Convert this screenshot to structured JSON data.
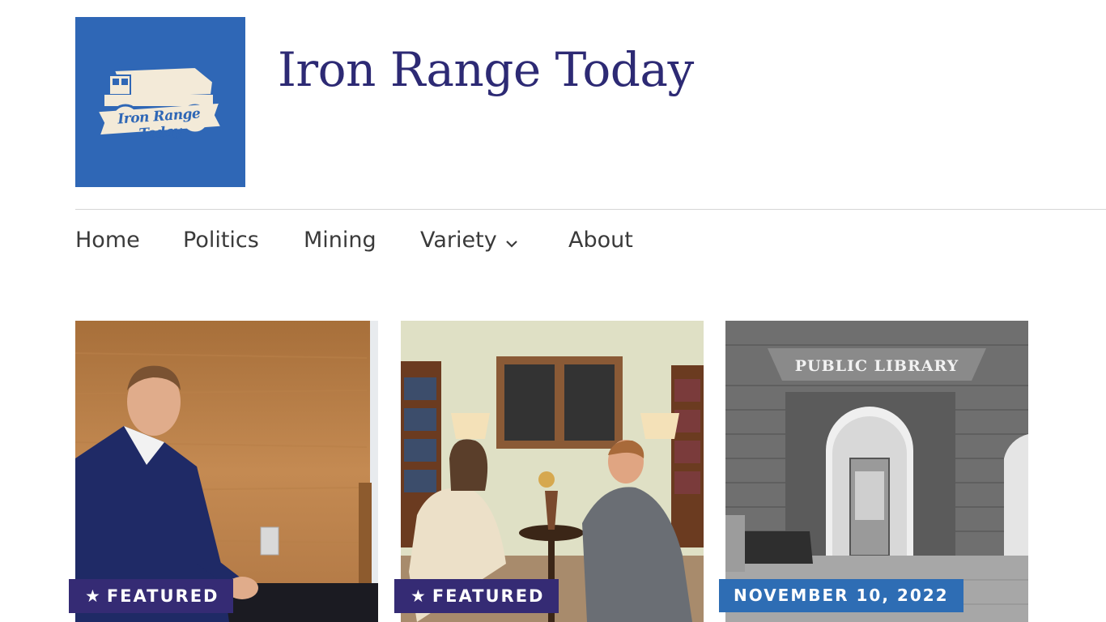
{
  "site": {
    "title": "Iron Range Today",
    "logo_text": "Iron Range Today",
    "logo_bg": "#2f67b6",
    "title_color": "#2d2a74"
  },
  "nav": {
    "items": [
      {
        "label": "Home"
      },
      {
        "label": "Politics"
      },
      {
        "label": "Mining"
      },
      {
        "label": "Variety",
        "has_dropdown": true,
        "icon": "chevron-down-icon"
      },
      {
        "label": "About"
      }
    ]
  },
  "cards": [
    {
      "badge": "FEATURED",
      "badge_icon": "star-icon",
      "badge_color": "#352b74"
    },
    {
      "badge": "FEATURED",
      "badge_icon": "star-icon",
      "badge_color": "#352b74"
    },
    {
      "date": "NOVEMBER 10, 2022",
      "sign": "PUBLIC LIBRARY",
      "date_color": "#2e6db4"
    }
  ]
}
